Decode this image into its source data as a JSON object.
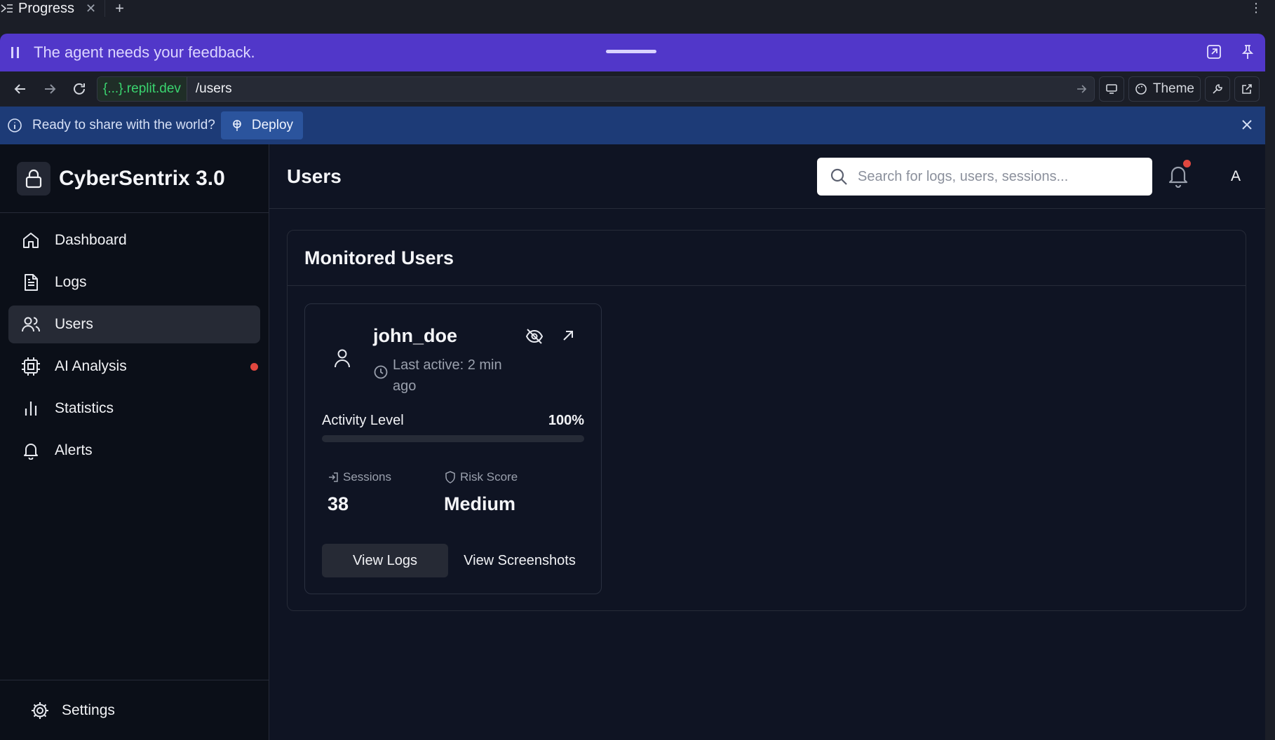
{
  "tab": {
    "title": "Progress",
    "close": "✕",
    "add": "+"
  },
  "feedback": {
    "text": "The agent needs your feedback."
  },
  "browser": {
    "domain": "{...}.replit.dev",
    "path": "/users",
    "theme_label": "Theme"
  },
  "deploybar": {
    "text": "Ready to share with the world?",
    "deploy_label": "Deploy"
  },
  "brand": {
    "name": "CyberSentrix 3.0"
  },
  "sidebar": {
    "items": [
      {
        "label": "Dashboard",
        "icon": "home-icon"
      },
      {
        "label": "Logs",
        "icon": "document-icon"
      },
      {
        "label": "Users",
        "icon": "users-icon",
        "active": true
      },
      {
        "label": "AI Analysis",
        "icon": "cpu-icon",
        "badge": true
      },
      {
        "label": "Statistics",
        "icon": "bar-chart-icon"
      },
      {
        "label": "Alerts",
        "icon": "bell-icon"
      }
    ],
    "settings_label": "Settings"
  },
  "header": {
    "title": "Users",
    "search_placeholder": "Search for logs, users, sessions...",
    "avatar_initial": "A",
    "notification_dot": true
  },
  "panel": {
    "title": "Monitored Users"
  },
  "user_card": {
    "username": "john_doe",
    "last_active": "Last active: 2 min ago",
    "activity_label": "Activity Level",
    "activity_value": "100%",
    "activity_fraction": 1.0,
    "sessions_label": "Sessions",
    "sessions_value": "38",
    "risk_label": "Risk Score",
    "risk_value": "Medium",
    "view_logs_label": "View Logs",
    "view_screenshots_label": "View Screenshots"
  },
  "colors": {
    "accent_purple": "#5137c9",
    "deploy_blue": "#1d3b77",
    "badge_red": "#e0473f",
    "url_green": "#3ad46f"
  }
}
